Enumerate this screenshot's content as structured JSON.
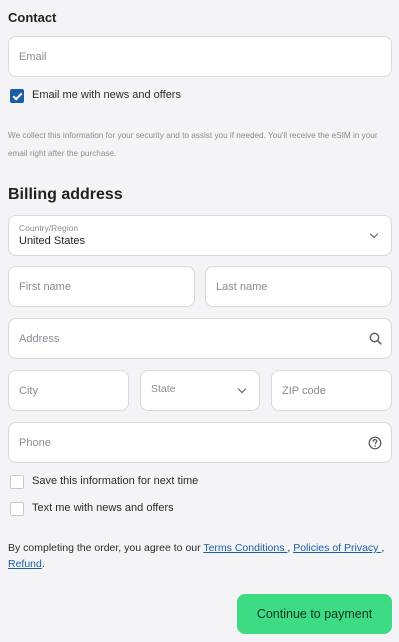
{
  "contact": {
    "heading": "Contact",
    "email_placeholder": "Email",
    "email_optin_label": "Email me with news and offers",
    "email_optin_checked": true,
    "note": "We collect this information for your security and to assist you if needed. You'll receive the eSIM in your email right after the purchase."
  },
  "billing": {
    "heading": "Billing address",
    "country_label": "Country/Region",
    "country_value": "United States",
    "first_name_placeholder": "First name",
    "last_name_placeholder": "Last name",
    "address_placeholder": "Address",
    "city_placeholder": "City",
    "state_placeholder": "State",
    "zip_placeholder": "ZIP code",
    "phone_placeholder": "Phone",
    "save_info_label": "Save this information for next time",
    "text_optin_label": "Text me with news and offers"
  },
  "terms": {
    "prefix": "By completing the order, you agree to our ",
    "terms_link": "Terms Conditions ",
    "sep1": ", ",
    "privacy_link": "Policies of Privacy ",
    "sep2": ", ",
    "refund_link": "Refund",
    "suffix": "."
  },
  "cta": {
    "label": "Continue to payment"
  },
  "colors": {
    "accent_green": "#3ddc84",
    "link_blue": "#1a5fa5",
    "checkbox_blue": "#1a5fa5"
  },
  "icons": {
    "select_chevron": "chevron-down-icon",
    "address_search": "search-icon",
    "phone_help": "help-circle-icon",
    "checkbox_check": "checkmark-icon"
  }
}
